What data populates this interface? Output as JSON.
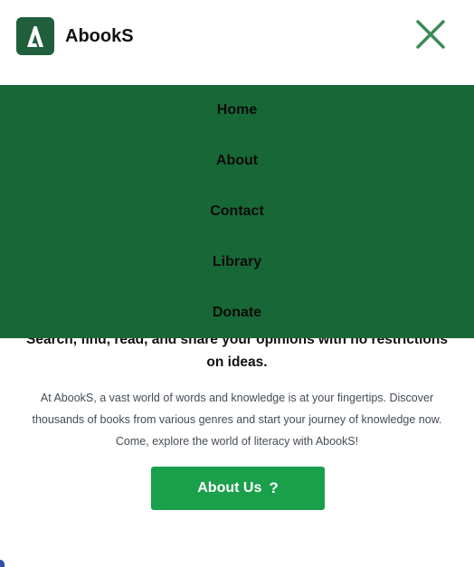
{
  "header": {
    "brand_name": "AbookS",
    "logo_icon": "abooks-logo-icon",
    "close_icon": "close-icon"
  },
  "nav": {
    "items": [
      {
        "label": "Home"
      },
      {
        "label": "About"
      },
      {
        "label": "Contact"
      },
      {
        "label": "Library"
      },
      {
        "label": "Donate"
      }
    ]
  },
  "hero": {
    "line1": "Search, find, read, and share your opinions with no restrictions",
    "line2": "on ideas.",
    "description": "At AbookS, a vast world of words and knowledge is at your fingertips. Discover thousands of books from various genres and start your journey of knowledge now. Come, explore the world of literacy with AbookS!",
    "button_label": "About Us",
    "button_icon": "?"
  },
  "colors": {
    "brand_dark": "#1f5f3b",
    "menu_bg": "#186837",
    "button_bg": "#1a9f4b",
    "close_icon": "#3b8a5a"
  }
}
